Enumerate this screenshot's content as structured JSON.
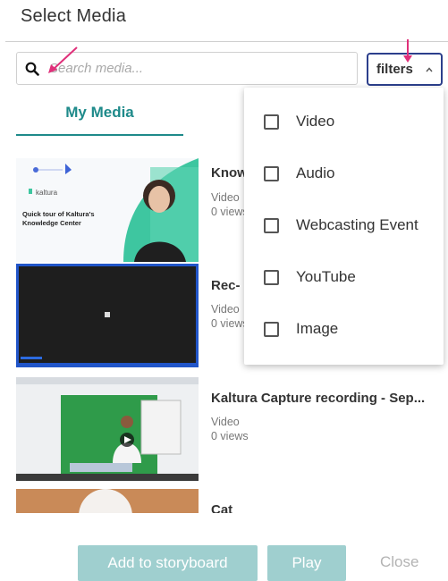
{
  "dialog": {
    "title": "Select Media"
  },
  "search": {
    "placeholder": "Search media...",
    "icon": "search-icon"
  },
  "filters": {
    "label": "filters",
    "icon": "chevron-up-icon",
    "border_color": "#2c3f8c"
  },
  "tabs": [
    {
      "label": "My Media",
      "active": true,
      "color": "#1e8a8a"
    }
  ],
  "media": [
    {
      "title": "Know",
      "type": "Video",
      "views": "0 views",
      "thumb_logo": "kaltura",
      "thumb_caption": "Quick tour of Kaltura's Knowledge Center"
    },
    {
      "title": "Rec- (",
      "type": "Video",
      "views": "0 views"
    },
    {
      "title": "Kaltura Capture recording - Sep...",
      "type": "Video",
      "views": "0 views"
    },
    {
      "title": "Cat"
    }
  ],
  "filter_options": [
    {
      "label": "Video",
      "checked": false
    },
    {
      "label": "Audio",
      "checked": false
    },
    {
      "label": "Webcasting Event",
      "checked": false
    },
    {
      "label": "YouTube",
      "checked": false
    },
    {
      "label": "Image",
      "checked": false
    }
  ],
  "footer": {
    "add_label": "Add to storyboard",
    "play_label": "Play",
    "close_label": "Close",
    "button_color": "#9fcfcf"
  },
  "annotation_color": "#e0307a"
}
